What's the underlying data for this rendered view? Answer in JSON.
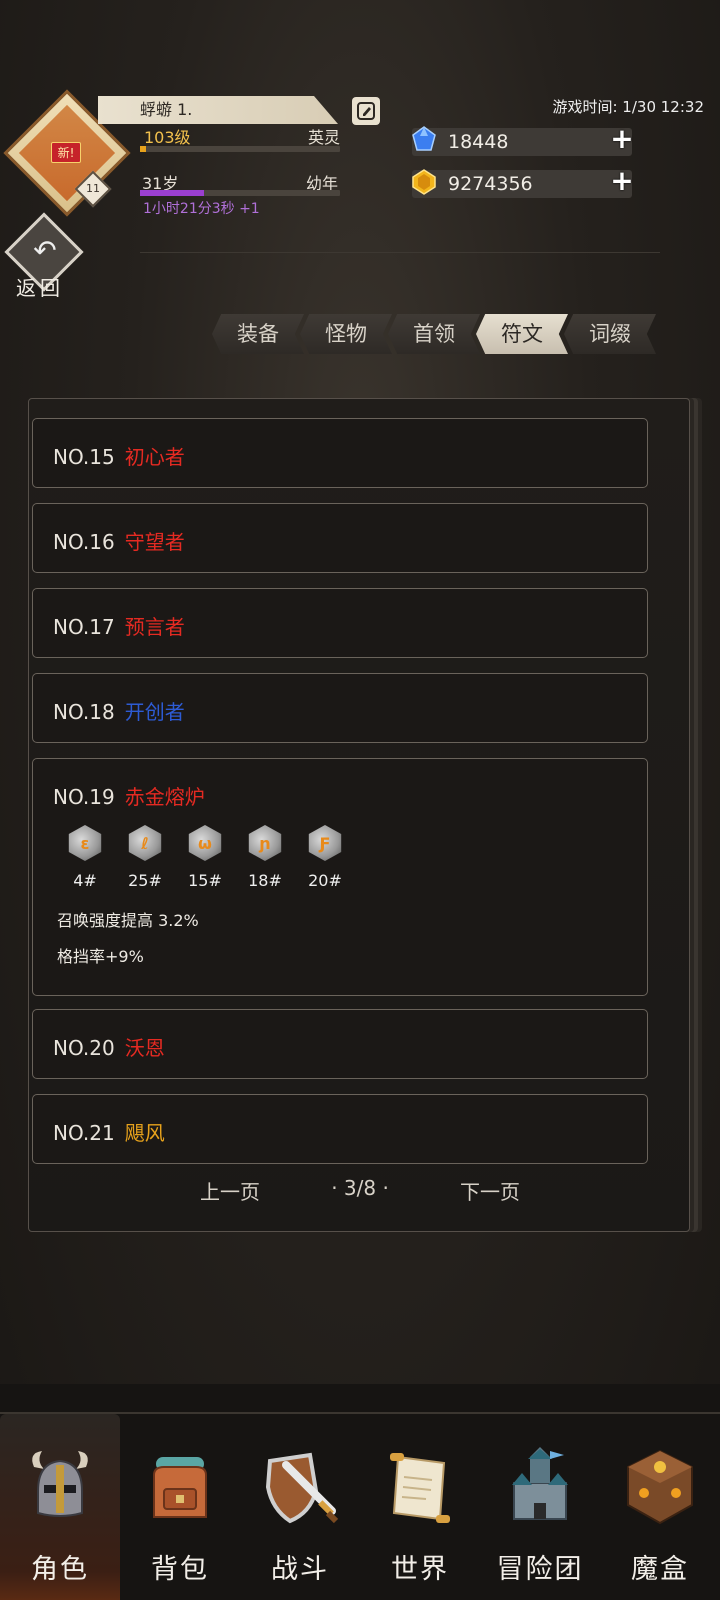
{
  "player": {
    "name": "蜉蝣 1.",
    "badge_new": "新!",
    "badge_level": "11",
    "level_label": "103级",
    "rank_label": "英灵",
    "level_progress": 0.03,
    "age_label": "31岁",
    "age_stage": "幼年",
    "age_progress": 0.32,
    "timer": "1小时21分3秒 +1"
  },
  "game_time": "游戏时间: 1/30 12:32",
  "currency": {
    "gems": "18448",
    "gold": "9274356"
  },
  "back": {
    "label": "返回"
  },
  "tabs": [
    {
      "label": "装备"
    },
    {
      "label": "怪物"
    },
    {
      "label": "首领"
    },
    {
      "label": "符文",
      "active": true
    },
    {
      "label": "词缀"
    }
  ],
  "entries": [
    {
      "num": "NO.15",
      "name": "初心者",
      "color": "#e52a22"
    },
    {
      "num": "NO.16",
      "name": "守望者",
      "color": "#e52a22"
    },
    {
      "num": "NO.17",
      "name": "预言者",
      "color": "#e52a22"
    },
    {
      "num": "NO.18",
      "name": "开创者",
      "color": "#2d5bd4"
    },
    {
      "num": "NO.19",
      "name": "赤金熔炉",
      "color": "#e52a22",
      "runes": [
        "4#",
        "25#",
        "15#",
        "18#",
        "20#"
      ],
      "effects": [
        "召唤强度提高 3.2%",
        "格挡率+9%"
      ]
    },
    {
      "num": "NO.20",
      "name": "沃恩",
      "color": "#e52a22"
    },
    {
      "num": "NO.21",
      "name": "飓风",
      "color": "#e7a21c"
    }
  ],
  "pager": {
    "prev": "上一页",
    "page": "· 3/8 ·",
    "next": "下一页"
  },
  "nav": [
    {
      "label": "角色",
      "icon": "helmet-icon",
      "active": true
    },
    {
      "label": "背包",
      "icon": "backpack-icon"
    },
    {
      "label": "战斗",
      "icon": "sword-shield-icon"
    },
    {
      "label": "世界",
      "icon": "scroll-icon"
    },
    {
      "label": "冒险团",
      "icon": "castle-icon"
    },
    {
      "label": "魔盒",
      "icon": "magic-box-icon"
    }
  ]
}
